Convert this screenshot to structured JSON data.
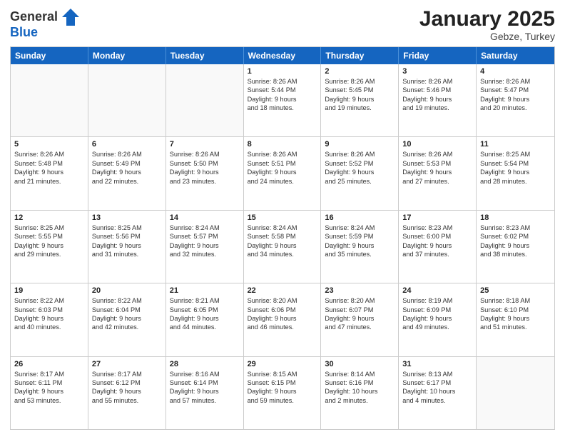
{
  "logo": {
    "general": "General",
    "blue": "Blue"
  },
  "header": {
    "month": "January 2025",
    "location": "Gebze, Turkey"
  },
  "weekdays": [
    "Sunday",
    "Monday",
    "Tuesday",
    "Wednesday",
    "Thursday",
    "Friday",
    "Saturday"
  ],
  "rows": [
    [
      {
        "day": "",
        "lines": []
      },
      {
        "day": "",
        "lines": []
      },
      {
        "day": "",
        "lines": []
      },
      {
        "day": "1",
        "lines": [
          "Sunrise: 8:26 AM",
          "Sunset: 5:44 PM",
          "Daylight: 9 hours",
          "and 18 minutes."
        ]
      },
      {
        "day": "2",
        "lines": [
          "Sunrise: 8:26 AM",
          "Sunset: 5:45 PM",
          "Daylight: 9 hours",
          "and 19 minutes."
        ]
      },
      {
        "day": "3",
        "lines": [
          "Sunrise: 8:26 AM",
          "Sunset: 5:46 PM",
          "Daylight: 9 hours",
          "and 19 minutes."
        ]
      },
      {
        "day": "4",
        "lines": [
          "Sunrise: 8:26 AM",
          "Sunset: 5:47 PM",
          "Daylight: 9 hours",
          "and 20 minutes."
        ]
      }
    ],
    [
      {
        "day": "5",
        "lines": [
          "Sunrise: 8:26 AM",
          "Sunset: 5:48 PM",
          "Daylight: 9 hours",
          "and 21 minutes."
        ]
      },
      {
        "day": "6",
        "lines": [
          "Sunrise: 8:26 AM",
          "Sunset: 5:49 PM",
          "Daylight: 9 hours",
          "and 22 minutes."
        ]
      },
      {
        "day": "7",
        "lines": [
          "Sunrise: 8:26 AM",
          "Sunset: 5:50 PM",
          "Daylight: 9 hours",
          "and 23 minutes."
        ]
      },
      {
        "day": "8",
        "lines": [
          "Sunrise: 8:26 AM",
          "Sunset: 5:51 PM",
          "Daylight: 9 hours",
          "and 24 minutes."
        ]
      },
      {
        "day": "9",
        "lines": [
          "Sunrise: 8:26 AM",
          "Sunset: 5:52 PM",
          "Daylight: 9 hours",
          "and 25 minutes."
        ]
      },
      {
        "day": "10",
        "lines": [
          "Sunrise: 8:26 AM",
          "Sunset: 5:53 PM",
          "Daylight: 9 hours",
          "and 27 minutes."
        ]
      },
      {
        "day": "11",
        "lines": [
          "Sunrise: 8:25 AM",
          "Sunset: 5:54 PM",
          "Daylight: 9 hours",
          "and 28 minutes."
        ]
      }
    ],
    [
      {
        "day": "12",
        "lines": [
          "Sunrise: 8:25 AM",
          "Sunset: 5:55 PM",
          "Daylight: 9 hours",
          "and 29 minutes."
        ]
      },
      {
        "day": "13",
        "lines": [
          "Sunrise: 8:25 AM",
          "Sunset: 5:56 PM",
          "Daylight: 9 hours",
          "and 31 minutes."
        ]
      },
      {
        "day": "14",
        "lines": [
          "Sunrise: 8:24 AM",
          "Sunset: 5:57 PM",
          "Daylight: 9 hours",
          "and 32 minutes."
        ]
      },
      {
        "day": "15",
        "lines": [
          "Sunrise: 8:24 AM",
          "Sunset: 5:58 PM",
          "Daylight: 9 hours",
          "and 34 minutes."
        ]
      },
      {
        "day": "16",
        "lines": [
          "Sunrise: 8:24 AM",
          "Sunset: 5:59 PM",
          "Daylight: 9 hours",
          "and 35 minutes."
        ]
      },
      {
        "day": "17",
        "lines": [
          "Sunrise: 8:23 AM",
          "Sunset: 6:00 PM",
          "Daylight: 9 hours",
          "and 37 minutes."
        ]
      },
      {
        "day": "18",
        "lines": [
          "Sunrise: 8:23 AM",
          "Sunset: 6:02 PM",
          "Daylight: 9 hours",
          "and 38 minutes."
        ]
      }
    ],
    [
      {
        "day": "19",
        "lines": [
          "Sunrise: 8:22 AM",
          "Sunset: 6:03 PM",
          "Daylight: 9 hours",
          "and 40 minutes."
        ]
      },
      {
        "day": "20",
        "lines": [
          "Sunrise: 8:22 AM",
          "Sunset: 6:04 PM",
          "Daylight: 9 hours",
          "and 42 minutes."
        ]
      },
      {
        "day": "21",
        "lines": [
          "Sunrise: 8:21 AM",
          "Sunset: 6:05 PM",
          "Daylight: 9 hours",
          "and 44 minutes."
        ]
      },
      {
        "day": "22",
        "lines": [
          "Sunrise: 8:20 AM",
          "Sunset: 6:06 PM",
          "Daylight: 9 hours",
          "and 46 minutes."
        ]
      },
      {
        "day": "23",
        "lines": [
          "Sunrise: 8:20 AM",
          "Sunset: 6:07 PM",
          "Daylight: 9 hours",
          "and 47 minutes."
        ]
      },
      {
        "day": "24",
        "lines": [
          "Sunrise: 8:19 AM",
          "Sunset: 6:09 PM",
          "Daylight: 9 hours",
          "and 49 minutes."
        ]
      },
      {
        "day": "25",
        "lines": [
          "Sunrise: 8:18 AM",
          "Sunset: 6:10 PM",
          "Daylight: 9 hours",
          "and 51 minutes."
        ]
      }
    ],
    [
      {
        "day": "26",
        "lines": [
          "Sunrise: 8:17 AM",
          "Sunset: 6:11 PM",
          "Daylight: 9 hours",
          "and 53 minutes."
        ]
      },
      {
        "day": "27",
        "lines": [
          "Sunrise: 8:17 AM",
          "Sunset: 6:12 PM",
          "Daylight: 9 hours",
          "and 55 minutes."
        ]
      },
      {
        "day": "28",
        "lines": [
          "Sunrise: 8:16 AM",
          "Sunset: 6:14 PM",
          "Daylight: 9 hours",
          "and 57 minutes."
        ]
      },
      {
        "day": "29",
        "lines": [
          "Sunrise: 8:15 AM",
          "Sunset: 6:15 PM",
          "Daylight: 9 hours",
          "and 59 minutes."
        ]
      },
      {
        "day": "30",
        "lines": [
          "Sunrise: 8:14 AM",
          "Sunset: 6:16 PM",
          "Daylight: 10 hours",
          "and 2 minutes."
        ]
      },
      {
        "day": "31",
        "lines": [
          "Sunrise: 8:13 AM",
          "Sunset: 6:17 PM",
          "Daylight: 10 hours",
          "and 4 minutes."
        ]
      },
      {
        "day": "",
        "lines": []
      }
    ]
  ]
}
